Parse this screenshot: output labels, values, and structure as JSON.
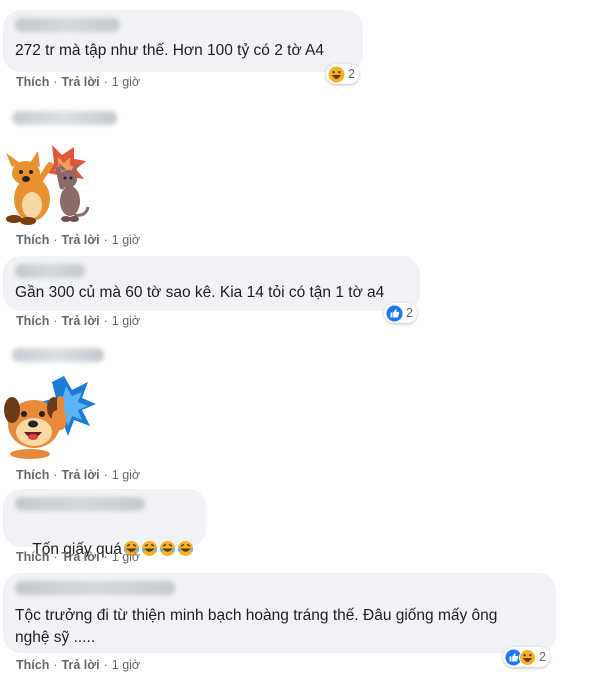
{
  "comments": [
    {
      "text": "272 tr mà tập như thế. Hơn 100 tỷ có 2 tờ A4",
      "reaction_count": "2",
      "reaction": "haha"
    },
    {
      "text": "Gần 300 củ mà 60 tờ sao kê. Kia 14 tỏi có tận 1 tờ a4",
      "reaction_count": "2",
      "reaction": "like"
    },
    {
      "text": "Tốn giấy quá",
      "reaction_count": "",
      "reaction": ""
    },
    {
      "text": "Tộc trưởng đi từ thiện minh bạch hoàng tráng thế. Đâu giống mấy ông\nnghệ sỹ .....",
      "reaction_count": "2",
      "reaction": "like-haha"
    }
  ],
  "meta": {
    "like": "Thích",
    "reply": "Trả lời",
    "time": "1 giờ",
    "sep": "·"
  },
  "colors": {
    "bubble": "#f0f2f5",
    "meta_text": "#65676b",
    "like_blue": "#1877f2",
    "haha_yellow": "#f7b125"
  },
  "icons": [
    "haha-icon",
    "like-icon",
    "dog-high-five-sticker",
    "dog-thumbs-up-sticker"
  ]
}
